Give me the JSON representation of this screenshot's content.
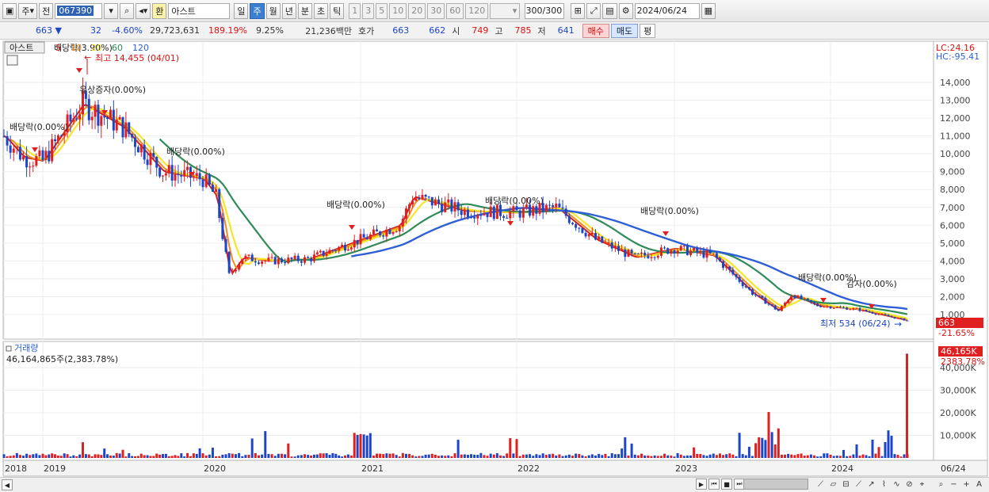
{
  "toolbar": {
    "market": "주",
    "prev": "전",
    "code": "067390",
    "name_badge": "환",
    "name": "아스트",
    "periods": [
      "일",
      "주",
      "월",
      "년",
      "분",
      "초",
      "틱"
    ],
    "period_selected": "주",
    "intervals": [
      "1",
      "3",
      "5",
      "10",
      "20",
      "30",
      "60",
      "120"
    ],
    "count": "300/300",
    "date": "2024/06/24"
  },
  "info": {
    "price": "663",
    "change": "32",
    "change_rate": "-4.60%",
    "volume": "29,723,631",
    "volume_rate": "189.19%",
    "turnover": "9.25%",
    "amount": "21,236백만",
    "quote_label": "호가",
    "ask": "663",
    "bid": "662",
    "open_label": "시",
    "open": "749",
    "high_label": "고",
    "high": "785",
    "low_label": "저",
    "low": "641",
    "buy_label": "매수",
    "sell_label": "매도",
    "pyeong_label": "평"
  },
  "chart": {
    "name_tab": "아스트",
    "ma_legend": [
      "5",
      "10",
      "20",
      "60",
      "120"
    ],
    "ma_colors": [
      "#d41c1c",
      "#f08c1c",
      "#f5e62a",
      "#2e8b57",
      "#2f5fd6"
    ],
    "lc_label": "LC:24.16",
    "hc_label": "HC:-95.41",
    "price_ticks": [
      "14,000",
      "13,000",
      "12,000",
      "11,000",
      "10,000",
      "9,000",
      "8,000",
      "7,000",
      "6,000",
      "5,000",
      "4,000",
      "3,000",
      "2,000",
      "1,000"
    ],
    "current_price": "663",
    "current_rate": "-21.65%",
    "high_note": "최고 14,455 (04/01)",
    "low_note": "최저 534 (06/24)",
    "events": [
      {
        "text": "배당락(0.00%)"
      },
      {
        "text": "배당락(3.90%)"
      },
      {
        "text": "유상증자(0.00%)"
      },
      {
        "text": "배당락(0.00%)"
      },
      {
        "text": "배당락(0.00%)"
      },
      {
        "text": "배당락(0.00%)"
      },
      {
        "text": "배당락(0.00%)"
      },
      {
        "text": "배당락(0.00%)"
      },
      {
        "text": "감자(0.00%)"
      }
    ],
    "volume_label": "거래량",
    "volume_value": "46,164,865주(2,383.78%)",
    "volume_badge": "46,165K",
    "volume_badge_rate": "2383.78%",
    "volume_ticks": [
      "40,000K",
      "30,000K",
      "20,000K",
      "10,000K"
    ],
    "x_labels": [
      "2018",
      "2019",
      "2020",
      "2021",
      "2022",
      "2023",
      "2024",
      "06/24"
    ]
  },
  "chart_data": {
    "type": "line",
    "title": "",
    "x": [
      "2018-01",
      "2018-07",
      "2019-01",
      "2019-04",
      "2019-07",
      "2019-10",
      "2020-01",
      "2020-02",
      "2020-03",
      "2020-04",
      "2020-06",
      "2020-09",
      "2021-01",
      "2021-04",
      "2021-05",
      "2021-06",
      "2021-09",
      "2022-01",
      "2022-04",
      "2022-07",
      "2022-10",
      "2023-01",
      "2023-04",
      "2023-07",
      "2023-09",
      "2023-10",
      "2023-12",
      "2024-03",
      "2024-06"
    ],
    "series": [
      {
        "values": [
          11000,
          9800,
          9600,
          12800,
          11500,
          9000,
          8600,
          7600,
          3200,
          4200,
          4000,
          4100,
          5200,
          6000,
          7600,
          7400,
          6800,
          6700,
          7000,
          5200,
          4200,
          4700,
          4300,
          2200,
          1200,
          2100,
          1500,
          1300,
          663
        ]
      }
    ],
    "ylabel": "",
    "ylim": [
      0,
      14500
    ],
    "volume_axis_ticks": [
      10000,
      20000,
      30000,
      40000
    ],
    "last_volume_k": 46165
  }
}
